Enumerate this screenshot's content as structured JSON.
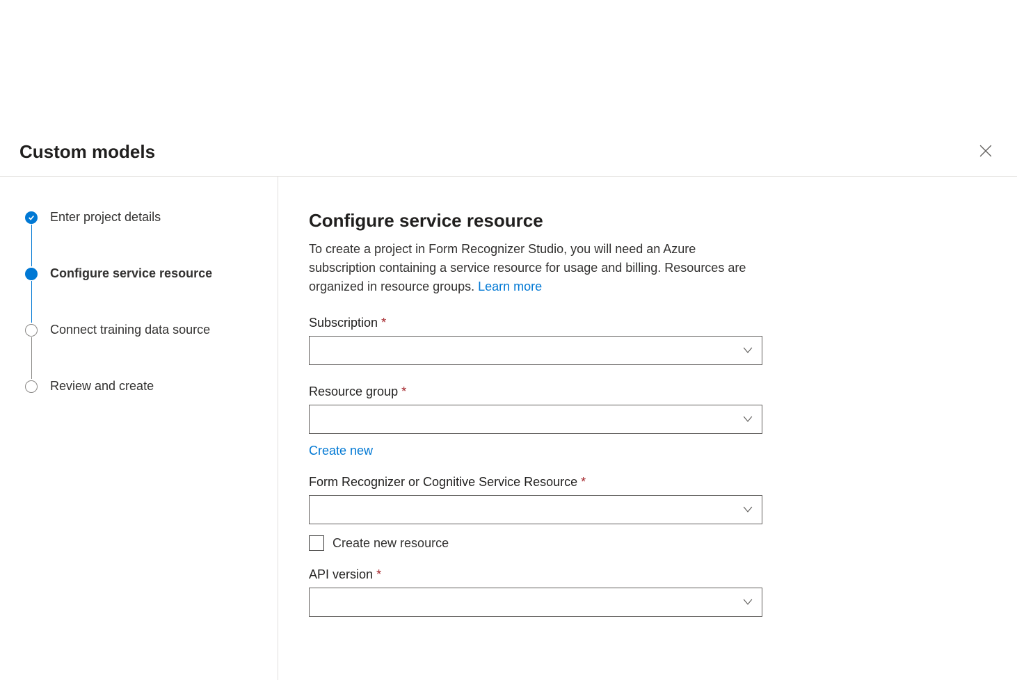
{
  "header": {
    "title": "Custom models"
  },
  "steps": [
    {
      "label": "Enter project details",
      "state": "completed"
    },
    {
      "label": "Configure service resource",
      "state": "current"
    },
    {
      "label": "Connect training data source",
      "state": "pending"
    },
    {
      "label": "Review and create",
      "state": "pending"
    }
  ],
  "main": {
    "heading": "Configure service resource",
    "description": "To create a project in Form Recognizer Studio, you will need an Azure subscription containing a service resource for usage and billing. Resources are organized in resource groups. ",
    "learn_more": "Learn more",
    "fields": {
      "subscription": {
        "label": "Subscription",
        "required": true,
        "value": ""
      },
      "resource_group": {
        "label": "Resource group",
        "required": true,
        "value": "",
        "create_link": "Create new"
      },
      "service_resource": {
        "label": "Form Recognizer or Cognitive Service Resource",
        "required": true,
        "value": "",
        "checkbox_label": "Create new resource",
        "checked": false
      },
      "api_version": {
        "label": "API version",
        "required": true,
        "value": ""
      }
    }
  }
}
